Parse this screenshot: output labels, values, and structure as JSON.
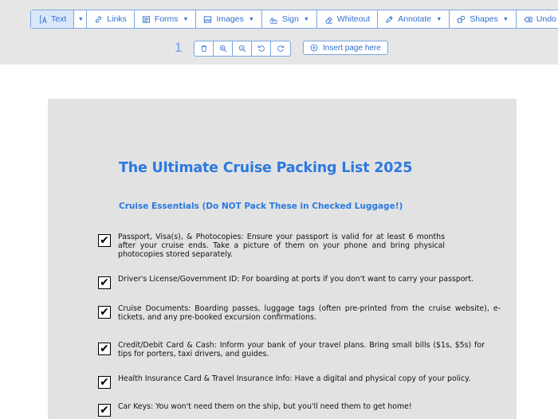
{
  "toolbar": {
    "text_label": "Text",
    "links_label": "Links",
    "forms_label": "Forms",
    "images_label": "Images",
    "sign_label": "Sign",
    "whiteout_label": "Whiteout",
    "annotate_label": "Annotate",
    "shapes_label": "Shapes",
    "undo_label": "Undo"
  },
  "page_controls": {
    "page_number": "1",
    "insert_page_label": "Insert page here"
  },
  "document": {
    "title": "The Ultimate Cruise Packing List 2025",
    "subtitle": "Cruise Essentials (Do NOT Pack These in Checked Luggage!)",
    "check_mark": "✔",
    "items": [
      {
        "text": "Passport, Visa(s), & Photocopies: Ensure your passport is valid for at least 6 months after your cruise ends. Take a picture of them on your phone and bring physical photocopies stored separately."
      },
      {
        "text": "Driver's License/Government ID: For boarding at ports if you don't want to carry your passport."
      },
      {
        "text": "Cruise Documents: Boarding passes, luggage tags (often pre-printed from the cruise website), e-tickets, and any pre-booked excursion confirmations."
      },
      {
        "text": "Credit/Debit Card & Cash: Inform your bank of your travel plans. Bring small bills ($1s, $5s) for tips for porters, taxi drivers, and guides."
      },
      {
        "text": "Health Insurance Card & Travel Insurance Info: Have a digital and physical copy of your policy."
      },
      {
        "text": "Car Keys: You won't need them on the ship, but you'll need them to get home!"
      }
    ]
  },
  "colors": {
    "accent": "#2f6fd0",
    "heading": "#2b79e0",
    "toolbar_bg": "#e6e6e6"
  }
}
